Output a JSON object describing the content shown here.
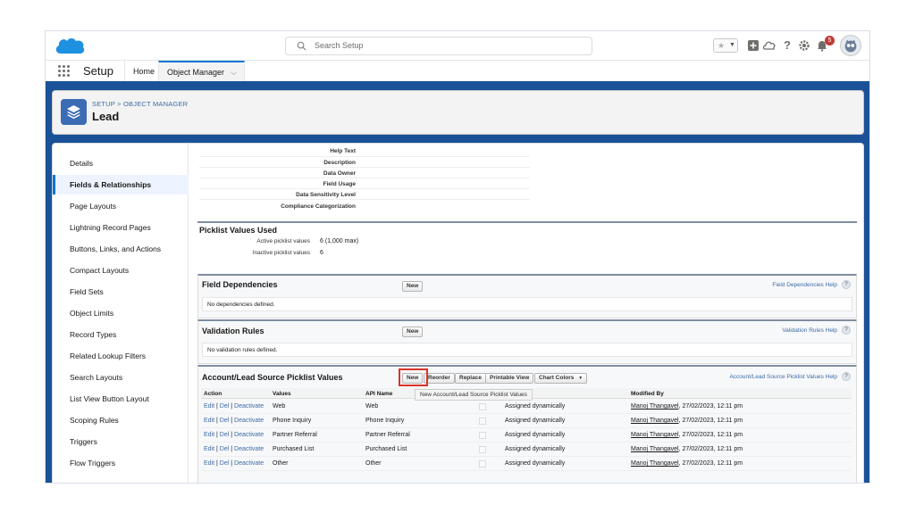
{
  "header": {
    "search_placeholder": "Search Setup",
    "notification_count": "5",
    "icons": [
      "star-icon",
      "add-icon",
      "trailhead-icon",
      "help-icon",
      "gear-icon",
      "bell-icon",
      "avatar"
    ]
  },
  "nav": {
    "app_name": "Setup",
    "tabs": [
      {
        "label": "Home"
      },
      {
        "label": "Object Manager",
        "active": true
      }
    ]
  },
  "page_header": {
    "breadcrumb": "SETUP > OBJECT MANAGER",
    "title": "Lead"
  },
  "sidebar": {
    "items": [
      {
        "label": "Details"
      },
      {
        "label": "Fields & Relationships",
        "active": true
      },
      {
        "label": "Page Layouts"
      },
      {
        "label": "Lightning Record Pages"
      },
      {
        "label": "Buttons, Links, and Actions"
      },
      {
        "label": "Compact Layouts"
      },
      {
        "label": "Field Sets"
      },
      {
        "label": "Object Limits"
      },
      {
        "label": "Record Types"
      },
      {
        "label": "Related Lookup Filters"
      },
      {
        "label": "Search Layouts"
      },
      {
        "label": "List View Button Layout"
      },
      {
        "label": "Scoping Rules"
      },
      {
        "label": "Triggers"
      },
      {
        "label": "Flow Triggers"
      }
    ]
  },
  "details": {
    "labels": [
      "Help Text",
      "Description",
      "Data Owner",
      "Field Usage",
      "Data Sensitivity Level",
      "Compliance Categorization"
    ]
  },
  "picklist_used": {
    "title": "Picklist Values Used",
    "active_label": "Active picklist values",
    "active_value": "6 (1,000 max)",
    "inactive_label": "Inactive picklist values",
    "inactive_value": "6"
  },
  "field_dependencies": {
    "title": "Field Dependencies",
    "new_label": "New",
    "help": "Field Dependencies Help",
    "empty": "No dependencies defined."
  },
  "validation_rules": {
    "title": "Validation Rules",
    "new_label": "New",
    "help": "Validation Rules Help",
    "empty": "No validation rules defined."
  },
  "picklist_values": {
    "title": "Account/Lead Source Picklist Values",
    "buttons": {
      "new": "New",
      "reorder": "Reorder",
      "replace": "Replace",
      "printable": "Printable View",
      "chart_colors": "Chart Colors"
    },
    "help": "Account/Lead Source Picklist Values Help",
    "tooltip": "New Account/Lead Source Picklist Values",
    "columns": [
      "Action",
      "Values",
      "API Name",
      "Modified By"
    ],
    "action_links": {
      "edit": "Edit",
      "del": "Del",
      "deactivate": "Deactivate",
      "sep": "|"
    },
    "rows": [
      {
        "value": "Web",
        "api": "Web",
        "color": "Assigned dynamically",
        "user": "Manoj Thangavel",
        "date": ", 27/02/2023, 12:11 pm"
      },
      {
        "value": "Phone Inquiry",
        "api": "Phone Inquiry",
        "color": "Assigned dynamically",
        "user": "Manoj Thangavel",
        "date": ", 27/02/2023, 12:11 pm"
      },
      {
        "value": "Partner Referral",
        "api": "Partner Referral",
        "color": "Assigned dynamically",
        "user": "Manoj Thangavel",
        "date": ", 27/02/2023, 12:11 pm"
      },
      {
        "value": "Purchased List",
        "api": "Purchased List",
        "color": "Assigned dynamically",
        "user": "Manoj Thangavel",
        "date": ", 27/02/2023, 12:11 pm"
      },
      {
        "value": "Other",
        "api": "Other",
        "color": "Assigned dynamically",
        "user": "Manoj Thangavel",
        "date": ", 27/02/2023, 12:11 pm"
      }
    ]
  },
  "colors": {
    "brand_blue": "#1b5297",
    "link": "#3e6ba5",
    "highlight": "#d9342b",
    "cloud": "#1e90e0"
  }
}
